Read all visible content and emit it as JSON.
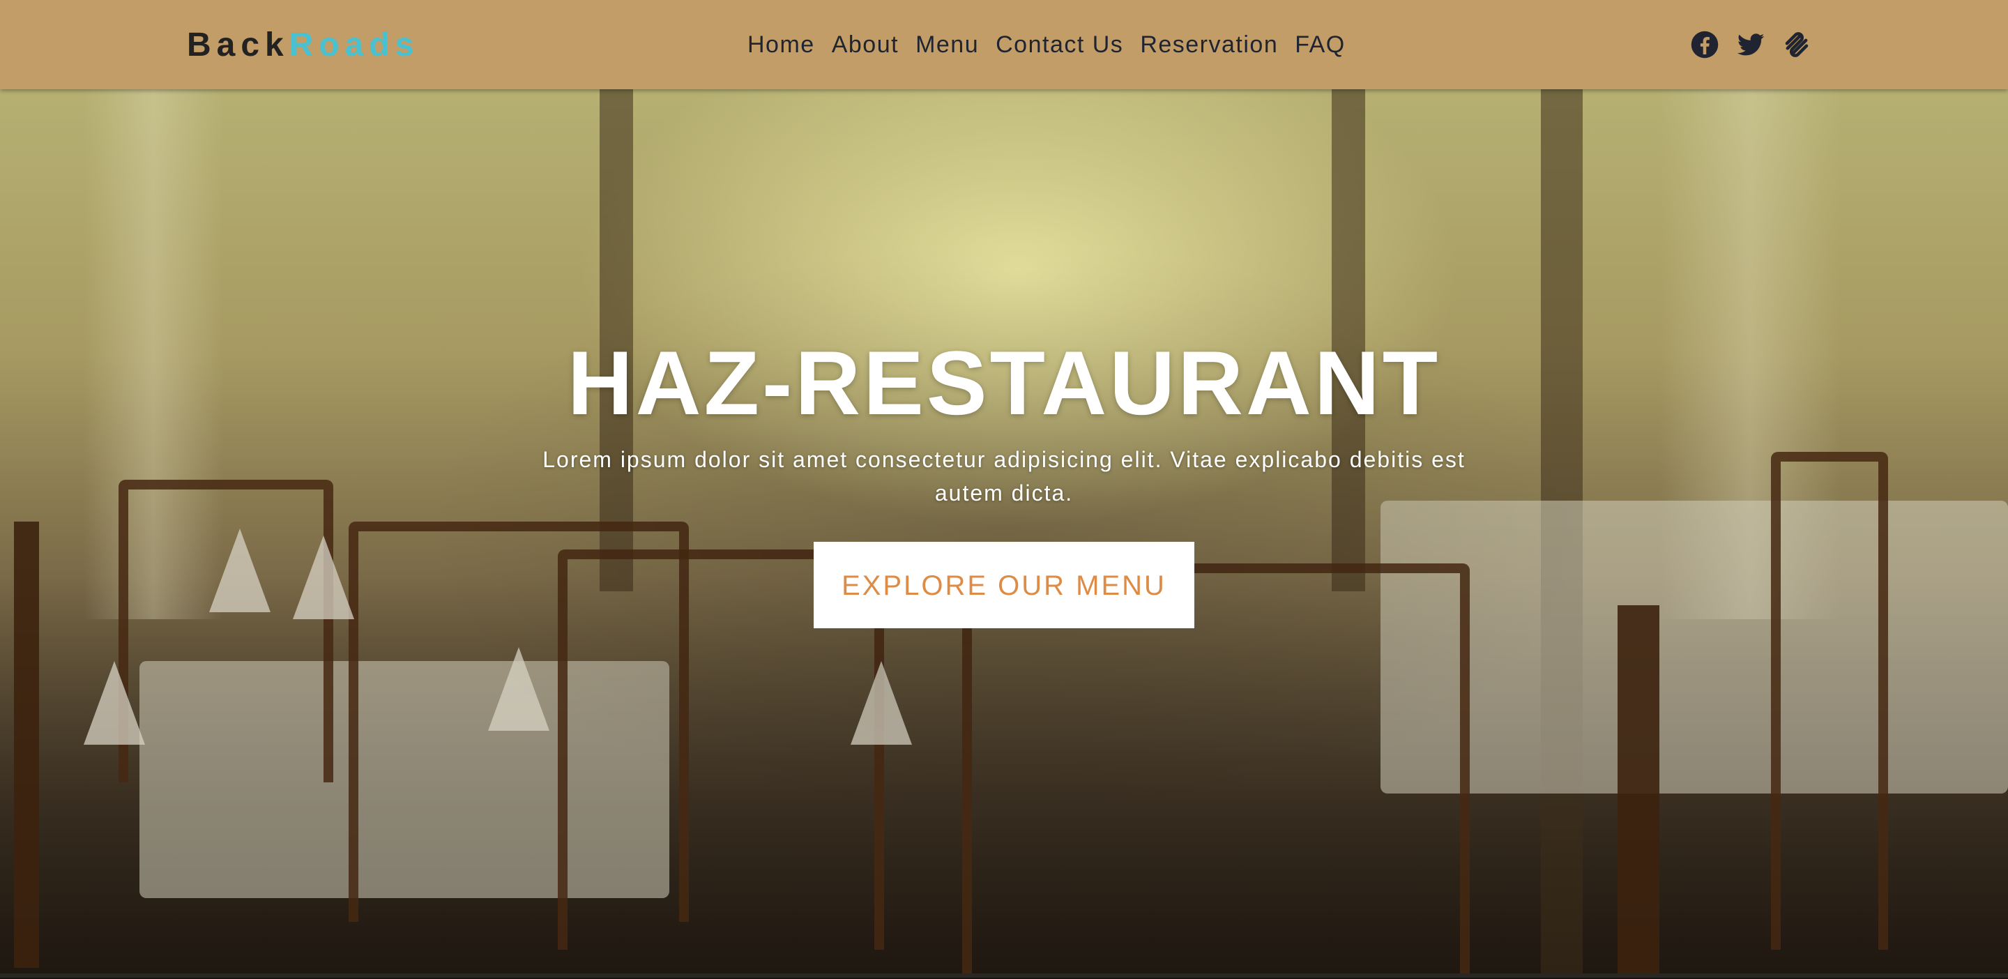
{
  "brand": {
    "part1": "Back",
    "part2": "Roads"
  },
  "nav": {
    "links": [
      "Home",
      "About",
      "Menu",
      "Contact Us",
      "Reservation",
      "FAQ"
    ]
  },
  "social": {
    "icons": [
      "facebook-icon",
      "twitter-icon",
      "squarespace-icon"
    ]
  },
  "hero": {
    "title": "HAZ-RESTAURANT",
    "subtitle": "Lorem ipsum dolor sit amet consectetur adipisicing elit. Vitae explicabo debitis est autem dicta.",
    "button_label": "EXPLORE OUR MENU"
  },
  "colors": {
    "navbar_bg": "#c29d68",
    "brand_dark": "#222222",
    "brand_accent": "#49c1d0",
    "button_text": "#de8b45"
  }
}
